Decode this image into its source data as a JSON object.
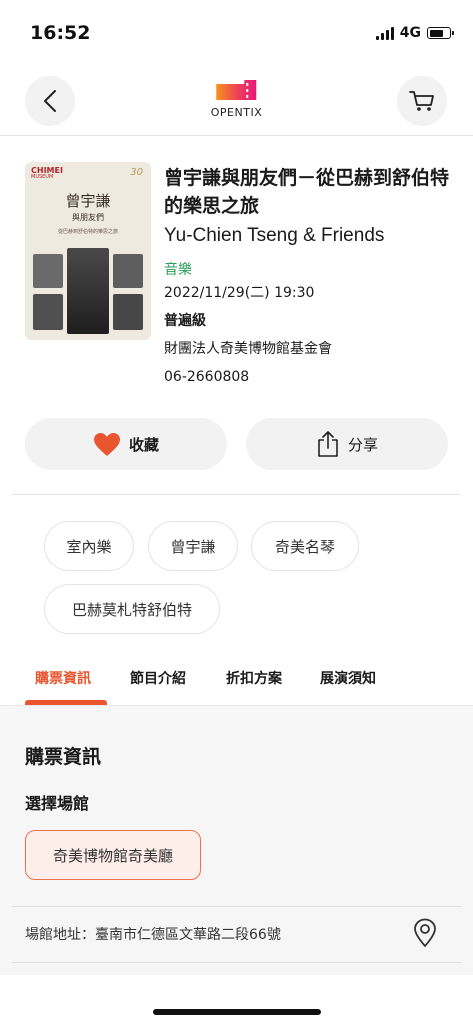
{
  "status_bar": {
    "time": "16:52",
    "network": "4G"
  },
  "nav": {
    "brand": "OPENTIX",
    "back_icon": "chevron-left-icon",
    "cart_icon": "cart-icon"
  },
  "poster": {
    "brand": "CHIMEI",
    "brand_sub": "MUSEUM",
    "title": "曾宇謙",
    "subtitle": "與朋友們",
    "line": "從巴赫到舒伯特的樂思之旅",
    "anniversary": "30"
  },
  "event": {
    "title": "曾宇謙與朋友們－從巴赫到舒伯特的樂思之旅",
    "title_en": "Yu-Chien Tseng & Friends",
    "category": "音樂",
    "datetime": "2022/11/29(二) 19:30",
    "rating": "普遍級",
    "organizer": "財團法人奇美博物館基金會",
    "phone": "06-2660808"
  },
  "actions": {
    "favorite_label": "收藏",
    "share_label": "分享",
    "heart_color": "#e8552f"
  },
  "tags": [
    "室內樂",
    "曾宇謙",
    "奇美名琴",
    "巴赫莫札特舒伯特"
  ],
  "tabs": [
    "購票資訊",
    "節目介紹",
    "折扣方案",
    "展演須知"
  ],
  "active_tab": "購票資訊",
  "ticket_info": {
    "heading": "購票資訊",
    "venue_heading": "選擇場館",
    "venue": "奇美博物館奇美廳",
    "address": "場館地址：臺南市仁德區文華路二段66號"
  },
  "colors": {
    "accent": "#e8552f",
    "category_green": "#2a9d5a",
    "chip_bg": "#fdeee9"
  }
}
